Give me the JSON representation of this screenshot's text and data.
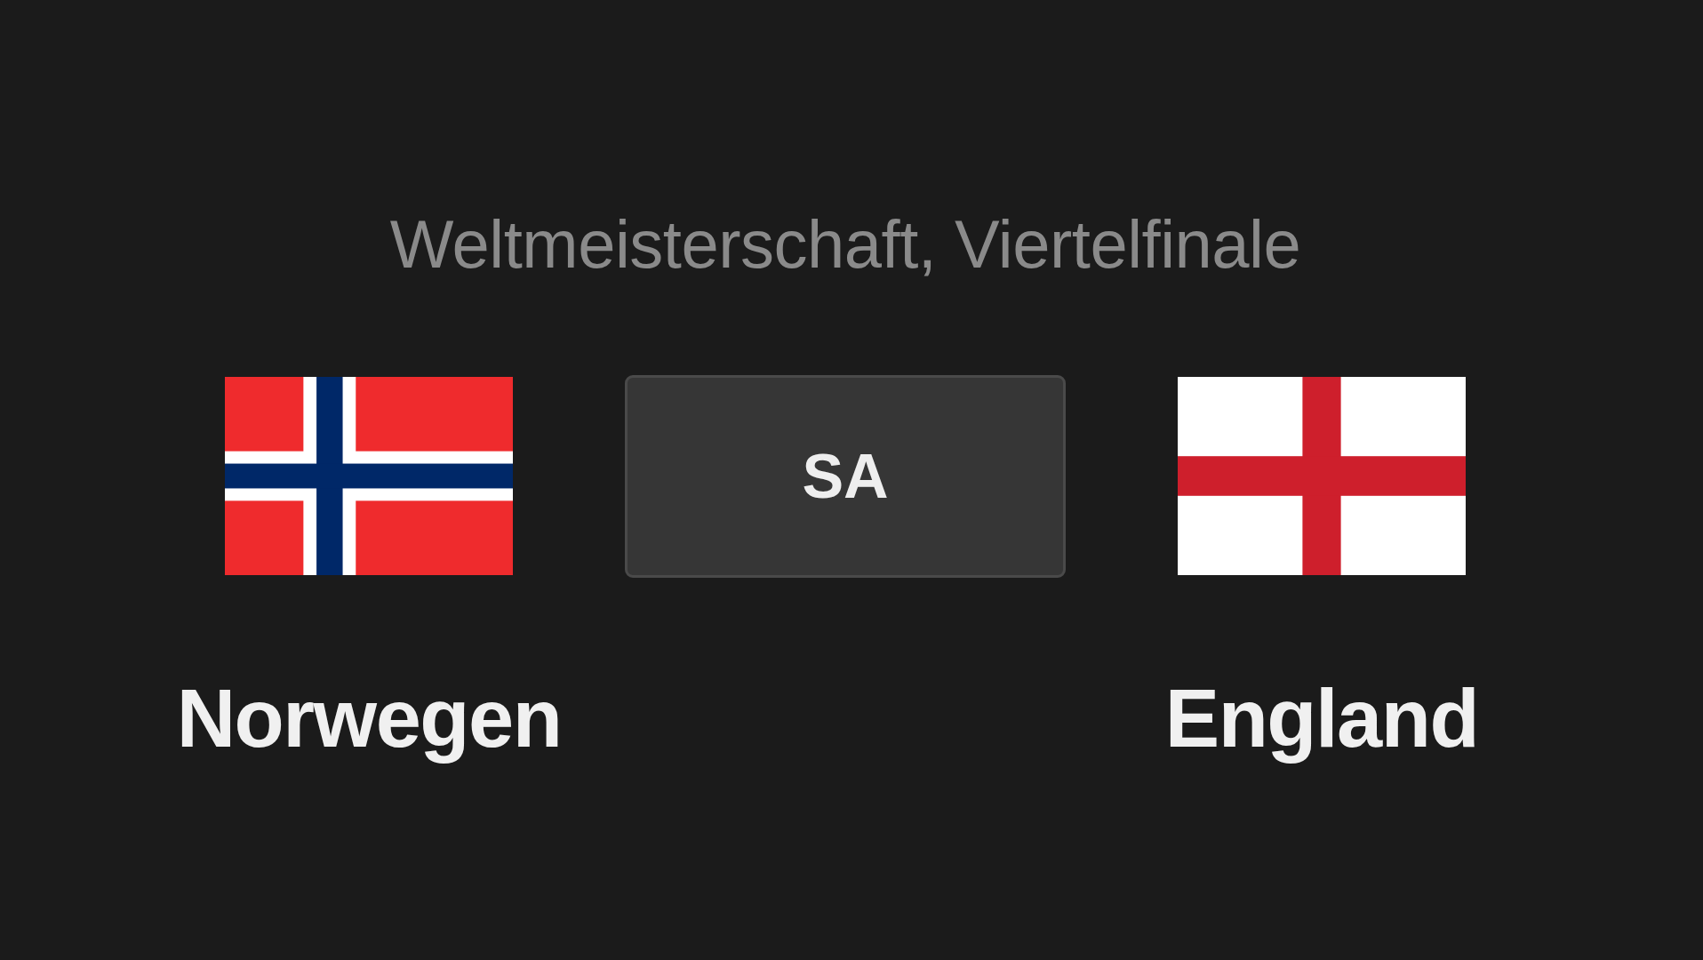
{
  "competition": "Weltmeisterschaft, Viertelfinale",
  "home": {
    "name": "Norwegen",
    "kind": "norway"
  },
  "score": {
    "text": "SA"
  },
  "away": {
    "name": "England",
    "kind": "england"
  }
}
